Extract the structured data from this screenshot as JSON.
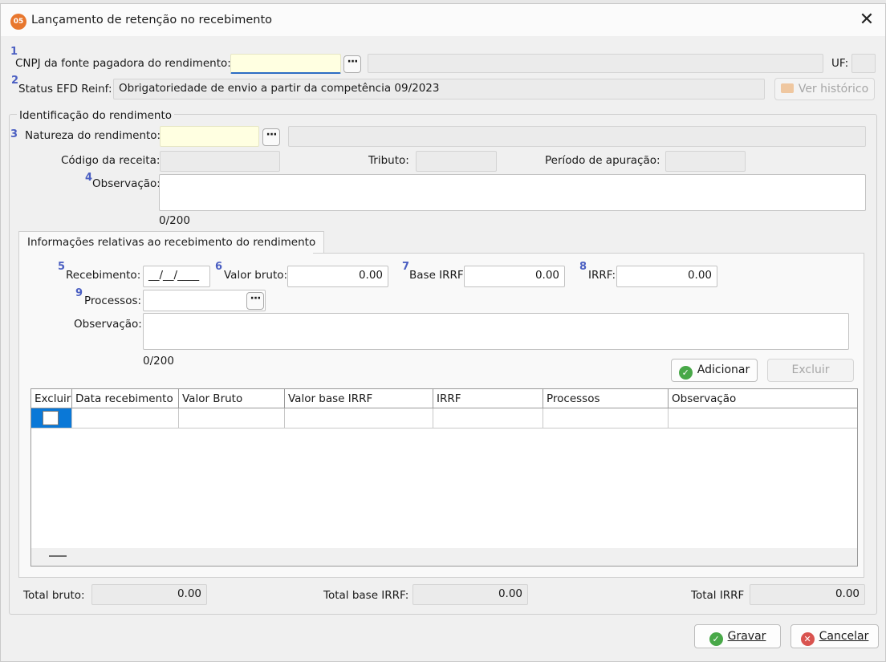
{
  "window": {
    "title": "Lançamento de retenção no recebimento",
    "app_icon_text": "05"
  },
  "markers": {
    "m1": "1",
    "m2": "2",
    "m3": "3",
    "m4": "4",
    "m5": "5",
    "m6": "6",
    "m7": "7",
    "m8": "8",
    "m9": "9"
  },
  "header": {
    "cnpj_label": "CNPJ da fonte pagadora do rendimento:",
    "cnpj_value": "",
    "cnpj_name_value": "",
    "uf_label": "UF:",
    "uf_value": "",
    "status_label": "Status EFD Reinf:",
    "status_value": "Obrigatoriedade de envio a partir da competência 09/2023",
    "ver_historico_label": "Ver histórico"
  },
  "identificacao": {
    "group_title": "Identificação do rendimento",
    "natureza_label": "Natureza do rendimento:",
    "natureza_value": "",
    "natureza_desc": "",
    "codigo_receita_label": "Código da receita:",
    "codigo_receita_value": "",
    "tributo_label": "Tributo:",
    "tributo_value": "",
    "periodo_label": "Período de apuração:",
    "periodo_value": "",
    "observacao_label": "Observação:",
    "observacao_value": "",
    "observacao_counter": "0/200"
  },
  "recebimento": {
    "tab_label": "Informações relativas ao recebimento do rendimento",
    "recebimento_label": "Recebimento:",
    "recebimento_value": "__/__/____",
    "valor_bruto_label": "Valor bruto:",
    "valor_bruto_value": "0.00",
    "base_irrf_label": "Base IRRF:",
    "base_irrf_value": "0.00",
    "irrf_label": "IRRF:",
    "irrf_value": "0.00",
    "processos_label": "Processos:",
    "processos_value": "",
    "observacao_label": "Observação:",
    "observacao_value": "",
    "observacao_counter": "0/200",
    "adicionar_label": "Adicionar",
    "excluir_label": "Excluir"
  },
  "grid": {
    "columns": [
      "Excluir",
      "Data recebimento",
      "Valor Bruto",
      "Valor base IRRF",
      "IRRF",
      "Processos",
      "Observação"
    ]
  },
  "totals": {
    "bruto_label": "Total bruto:",
    "bruto_value": "0.00",
    "base_label": "Total base IRRF:",
    "base_value": "0.00",
    "irrf_label": "Total IRRF",
    "irrf_value": "0.00"
  },
  "footer": {
    "gravar_label": "Gravar",
    "cancelar_label": "Cancelar"
  }
}
